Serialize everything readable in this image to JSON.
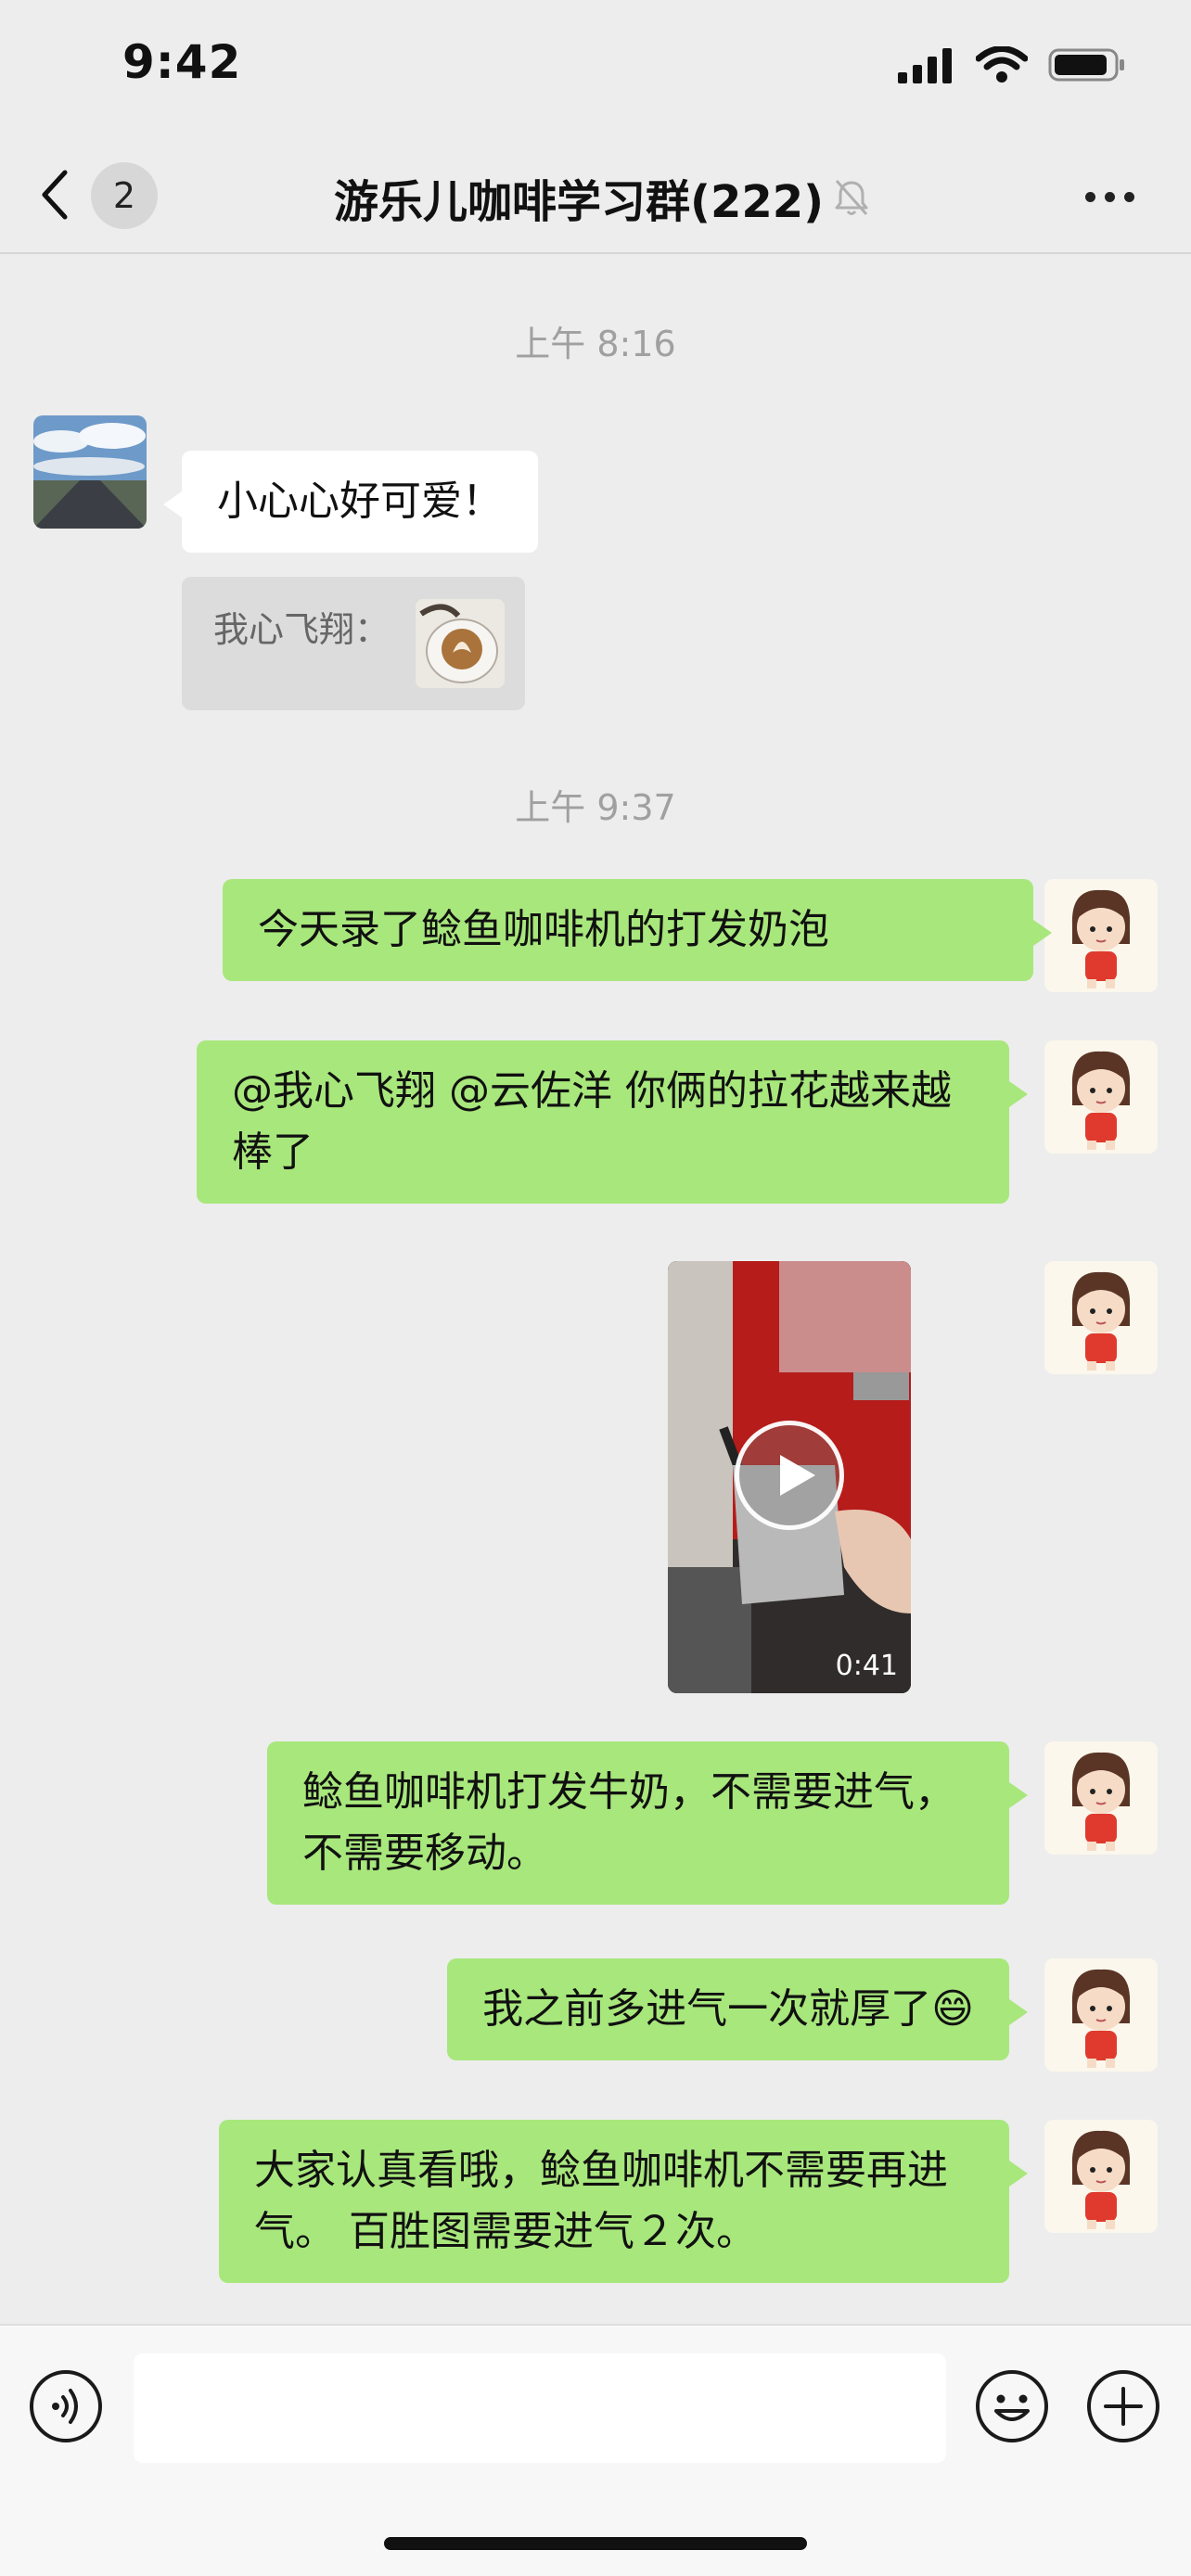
{
  "status_bar": {
    "time": "9:42"
  },
  "nav": {
    "back_badge": "2",
    "title": "游乐儿咖啡学习群(222)"
  },
  "messages": {
    "ts1": "上午 8:16",
    "m1_text": "小心心好可爱！",
    "m1_quote": "我心飞翔：",
    "ts2": "上午 9:37",
    "m2_text": "今天录了鲶鱼咖啡机的打发奶泡",
    "m3_text": "@我心飞翔 @云佐洋 你俩的拉花越来越棒了",
    "m4_video_duration": "0:41",
    "m5_text": "鲶鱼咖啡机打发牛奶，不需要进气，不需要移动。",
    "m6_text": "我之前多进气一次就厚了😄",
    "m7_text": "大家认真看哦，鲶鱼咖啡机不需要再进气。 百胜图需要进气２次。"
  },
  "icons": {
    "back": "chevron-left-icon",
    "mute": "bell-off-icon",
    "more": "ellipsis-icon",
    "voice": "voice-icon",
    "emoji": "emoji-icon",
    "plus": "plus-icon"
  },
  "colors": {
    "accent_bubble": "#a8e77c",
    "background": "#ededed"
  }
}
